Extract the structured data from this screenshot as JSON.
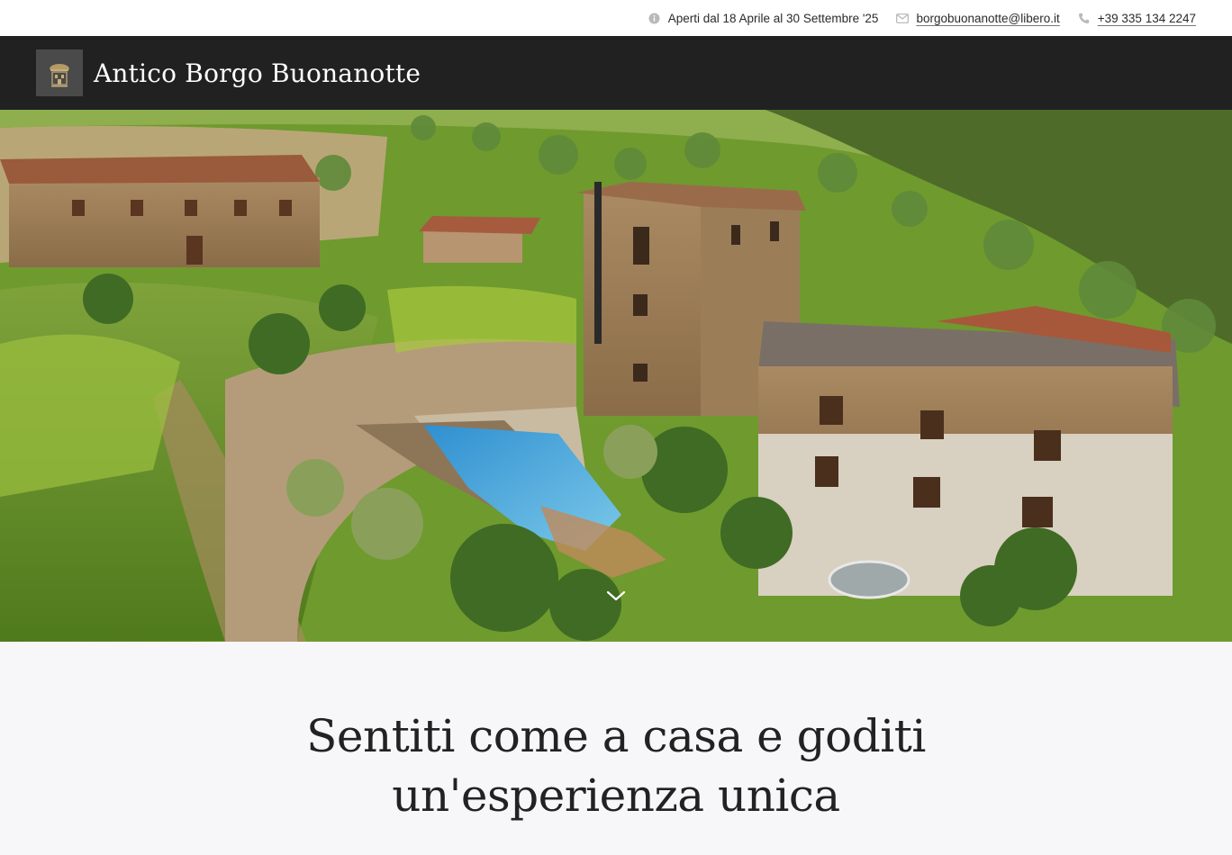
{
  "topbar": {
    "hours_text": "Aperti dal 18 Aprile al 30 Settembre '25",
    "hours_icon": "info-icon",
    "email": "borgobuonanotte@libero.it",
    "email_icon": "mail-icon",
    "phone": "+39 335 134 2247",
    "phone_icon": "phone-icon"
  },
  "header": {
    "title": "Antico Borgo Buonanotte",
    "logo_icon": "borgo-logo"
  },
  "hero": {
    "image_label": "hero-photo",
    "scroll_icon": "chevron-down-icon"
  },
  "intro": {
    "headline_line1": "Sentiti come a casa e goditi",
    "headline_line2": "un'esperienza unica"
  },
  "colors": {
    "header_bg": "#212121",
    "topbar_bg": "#ffffff",
    "page_bg": "#f7f6f8",
    "text": "#222222"
  }
}
